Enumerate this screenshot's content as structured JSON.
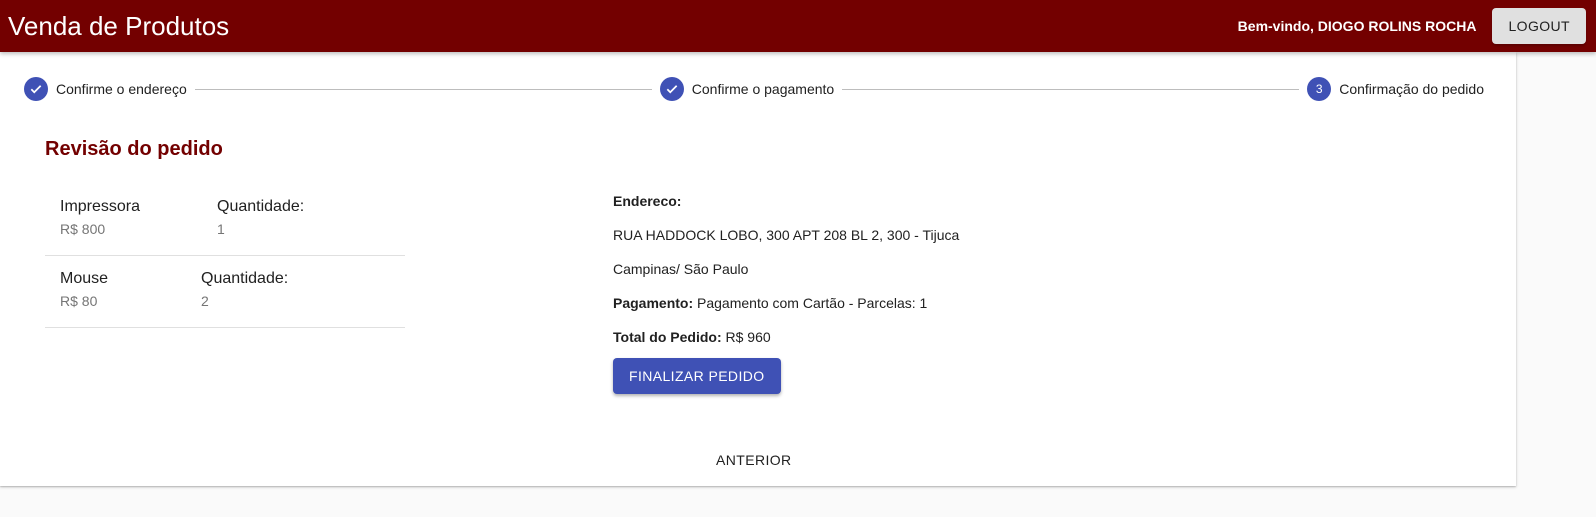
{
  "appbar": {
    "title": "Venda de Produtos",
    "welcome": "Bem-vindo, DIOGO ROLINS ROCHA",
    "logout_label": "LOGOUT",
    "color": "#730000"
  },
  "stepper": {
    "steps": [
      {
        "label": "Confirme o endereço",
        "state": "completed",
        "icon": "check-icon"
      },
      {
        "label": "Confirme o pagamento",
        "state": "completed",
        "icon": "check-icon"
      },
      {
        "label": "Confirmação do pedido",
        "state": "active",
        "number": "3"
      }
    ],
    "accent": "#3f51b5"
  },
  "review": {
    "title": "Revisão do pedido",
    "items": [
      {
        "name": "Impressora",
        "price": "R$ 800",
        "qty_label": "Quantidade:",
        "qty": "1"
      },
      {
        "name": "Mouse",
        "price": "R$ 80",
        "qty_label": "Quantidade:",
        "qty": "2"
      }
    ]
  },
  "summary": {
    "address_label": "Endereco:",
    "address_line1": "RUA HADDOCK LOBO, 300 APT 208 BL 2, 300 - Tijuca",
    "address_line2": "Campinas/ São Paulo",
    "payment_label": "Pagamento:",
    "payment_value": " Pagamento com Cartão - Parcelas: 1",
    "total_label": "Total do Pedido:",
    "total_value": " R$ 960"
  },
  "actions": {
    "finalize_label": "FINALIZAR PEDIDO",
    "back_label": "ANTERIOR"
  }
}
